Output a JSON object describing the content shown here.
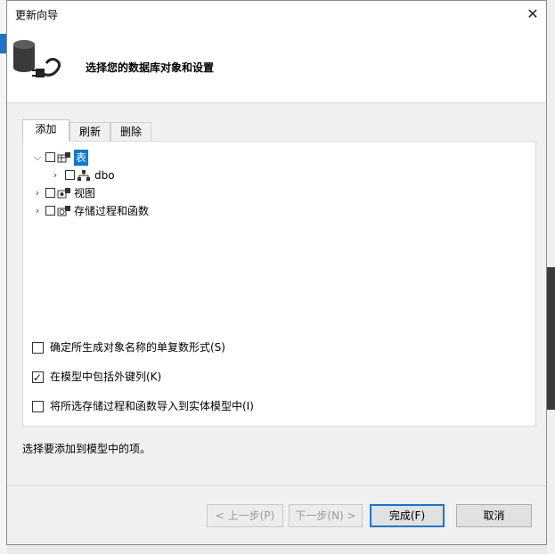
{
  "window": {
    "title": "更新向导",
    "close_label": "✕"
  },
  "header": {
    "title": "选择您的数据库对象和设置",
    "icon": "database-plug-icon"
  },
  "tabs": [
    {
      "label": "添加",
      "active": true
    },
    {
      "label": "刷新",
      "active": false
    },
    {
      "label": "删除",
      "active": false
    }
  ],
  "tree": {
    "tables": {
      "label": "表",
      "expanded": true,
      "checked": false,
      "selected": true
    },
    "dbo": {
      "label": "dbo",
      "expanded": false,
      "checked": false
    },
    "views": {
      "label": "视图",
      "expanded": false,
      "checked": false
    },
    "procs": {
      "label": "存储过程和函数",
      "expanded": false,
      "checked": false
    }
  },
  "options": [
    {
      "label": "确定所生成对象名称的单复数形式(S)",
      "checked": false
    },
    {
      "label": "在模型中包括外键列(K)",
      "checked": true
    },
    {
      "label": "将所选存储过程和函数导入到实体模型中(I)",
      "checked": false
    }
  ],
  "status_text": "选择要添加到模型中的项。",
  "buttons": {
    "back": "< 上一步(P)",
    "next": "下一步(N) >",
    "finish": "完成(F)",
    "cancel": "取消"
  },
  "colors": {
    "selection": "#0b77d7",
    "primary_border": "#0b77d7"
  }
}
